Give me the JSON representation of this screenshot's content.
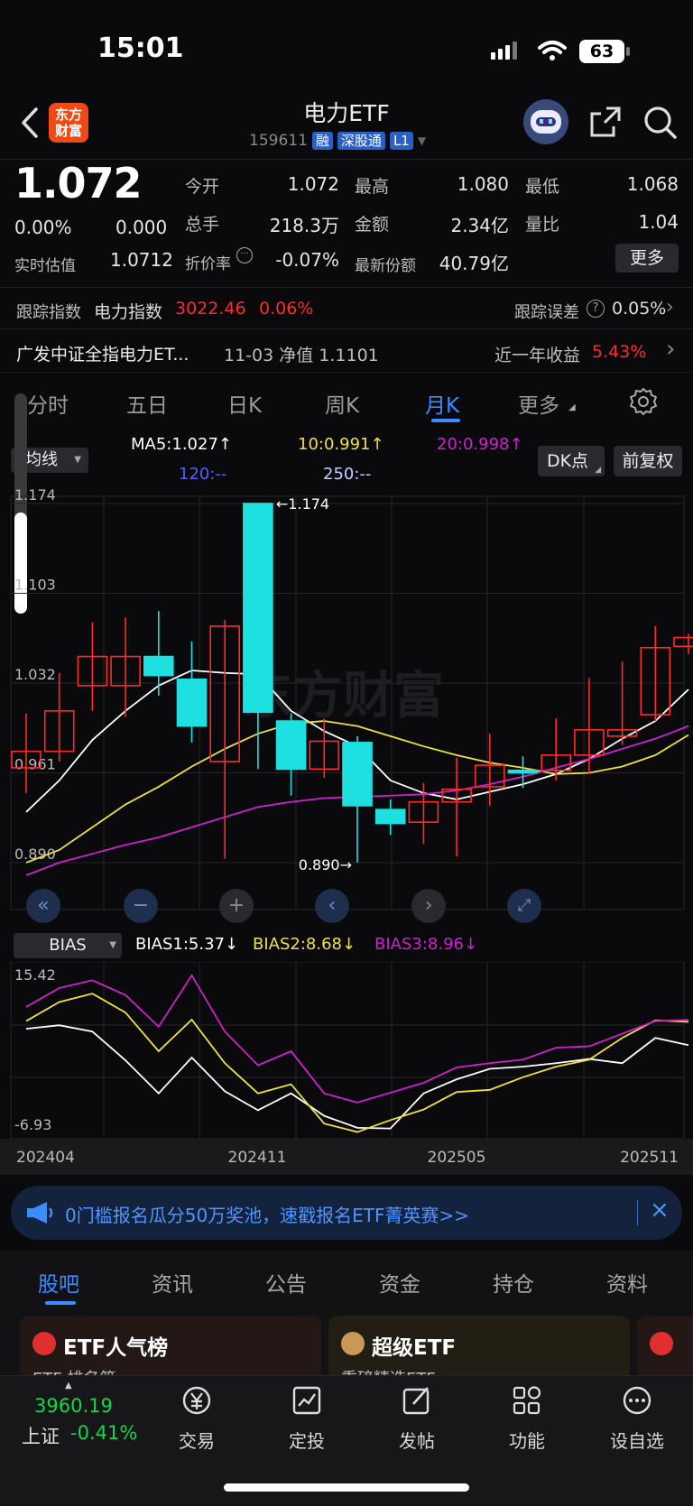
{
  "status_bar": {
    "time": "15:01",
    "battery": "63"
  },
  "header": {
    "logo_line1": "东方",
    "logo_line2": "财富",
    "title": "电力ETF",
    "code": "159611",
    "tags": [
      "融",
      "深股通",
      "L1"
    ]
  },
  "quote": {
    "price": "1.072",
    "change_pct": "0.00%",
    "change": "0.000",
    "iopv_label": "实时估值",
    "iopv": "1.0712",
    "open_label": "今开",
    "open": "1.072",
    "high_label": "最高",
    "high": "1.080",
    "low_label": "最低",
    "low": "1.068",
    "volume_label": "总手",
    "volume": "218.3万",
    "amount_label": "金额",
    "amount": "2.34亿",
    "ratio_label": "量比",
    "ratio": "1.04",
    "discount_label": "折价率",
    "discount": "-0.07%",
    "shares_label": "最新份额",
    "shares": "40.79亿",
    "more_button": "更多"
  },
  "tracking": {
    "label": "跟踪指数",
    "index_name": "电力指数",
    "index_value": "3022.46",
    "index_change": "0.06%",
    "error_label": "跟踪误差",
    "error_value": "0.05%"
  },
  "fund": {
    "name": "广发中证全指电力ET...",
    "nav_text": "11-03 净值 1.1101",
    "return_label": "近一年收益",
    "return_value": "5.43%"
  },
  "ktabs": {
    "items": [
      "分时",
      "五日",
      "日K",
      "周K",
      "月K",
      "更多"
    ],
    "active": "月K"
  },
  "ma": {
    "selector": "均线",
    "ma5": "MA5:1.027↑",
    "ma10": "10:0.991↑",
    "ma20": "20:0.998↑",
    "ma120": "120:--",
    "ma250": "250:--",
    "dk_button": "DK点",
    "adjust_button": "前复权"
  },
  "colors": {
    "up": "#ff2a2a",
    "down": "#1fe0e0",
    "ma5": "#ffffff",
    "ma10": "#f0e040",
    "ma20": "#d020d0",
    "ma120": "#5060ff",
    "ma250": "#c0d0ff",
    "accent": "#3b8cff"
  },
  "chart_data": [
    {
      "type": "candlestick",
      "title": "月K",
      "y_ticks": [
        "1.174",
        "1.103",
        "1.032",
        "0.961",
        "0.890"
      ],
      "ylim": [
        0.89,
        1.174
      ],
      "max_label": "1.174",
      "min_label": "0.890",
      "x_ticks": [
        "202404",
        "202411",
        "202505",
        "202511"
      ],
      "watermark": "东方财富",
      "candles": [
        {
          "o": 0.965,
          "c": 0.978,
          "h": 1.008,
          "l": 0.945
        },
        {
          "o": 0.978,
          "c": 1.01,
          "h": 1.04,
          "l": 0.97
        },
        {
          "o": 1.03,
          "c": 1.053,
          "h": 1.08,
          "l": 1.01
        },
        {
          "o": 1.03,
          "c": 1.053,
          "h": 1.084,
          "l": 1.005
        },
        {
          "o": 1.053,
          "c": 1.038,
          "h": 1.089,
          "l": 1.022
        },
        {
          "o": 1.035,
          "c": 0.998,
          "h": 1.065,
          "l": 0.985
        },
        {
          "o": 0.97,
          "c": 1.077,
          "h": 1.082,
          "l": 0.893
        },
        {
          "o": 1.174,
          "c": 1.009,
          "h": 1.174,
          "l": 0.964
        },
        {
          "o": 1.002,
          "c": 0.964,
          "h": 1.008,
          "l": 0.943
        },
        {
          "o": 0.964,
          "c": 0.986,
          "h": 1.004,
          "l": 0.957
        },
        {
          "o": 0.985,
          "c": 0.935,
          "h": 0.99,
          "l": 0.89
        },
        {
          "o": 0.932,
          "c": 0.921,
          "h": 0.94,
          "l": 0.912
        },
        {
          "o": 0.922,
          "c": 0.938,
          "h": 0.953,
          "l": 0.905
        },
        {
          "o": 0.938,
          "c": 0.948,
          "h": 0.973,
          "l": 0.895
        },
        {
          "o": 0.95,
          "c": 0.967,
          "h": 0.992,
          "l": 0.935
        },
        {
          "o": 0.963,
          "c": 0.961,
          "h": 0.974,
          "l": 0.949
        },
        {
          "o": 0.963,
          "c": 0.975,
          "h": 1.004,
          "l": 0.955
        },
        {
          "o": 0.975,
          "c": 0.995,
          "h": 1.036,
          "l": 0.96
        },
        {
          "o": 0.99,
          "c": 0.995,
          "h": 1.049,
          "l": 0.983
        },
        {
          "o": 1.007,
          "c": 1.06,
          "h": 1.077,
          "l": 1.002
        },
        {
          "o": 1.061,
          "c": 1.068,
          "h": 1.071,
          "l": 1.055
        }
      ],
      "series": [
        {
          "name": "MA5",
          "values": [
            0.93,
            0.955,
            0.987,
            1.01,
            1.03,
            1.042,
            1.04,
            1.039,
            1.01,
            0.994,
            0.982,
            0.955,
            0.945,
            0.94,
            0.946,
            0.952,
            0.96,
            0.972,
            0.988,
            1.002,
            1.027
          ]
        },
        {
          "name": "10",
          "values": [
            0.89,
            0.9,
            0.918,
            0.936,
            0.95,
            0.966,
            0.98,
            0.992,
            1.0,
            1.002,
            0.998,
            0.99,
            0.982,
            0.975,
            0.969,
            0.965,
            0.96,
            0.961,
            0.966,
            0.975,
            0.991
          ]
        },
        {
          "name": "20",
          "values": [
            0.88,
            0.89,
            0.897,
            0.904,
            0.91,
            0.918,
            0.926,
            0.934,
            0.938,
            0.941,
            0.942,
            0.943,
            0.944,
            0.947,
            0.952,
            0.958,
            0.965,
            0.972,
            0.98,
            0.988,
            0.998
          ]
        }
      ]
    },
    {
      "type": "line",
      "title": "BIAS",
      "ylim": [
        -6.93,
        15.42
      ],
      "y_ticks": [
        "15.42",
        "-6.93"
      ],
      "series": [
        {
          "name": "BIAS1:5.37↓",
          "values": [
            7.7,
            8.2,
            7.3,
            3.2,
            -1.5,
            3.6,
            -1.2,
            -3.9,
            -1.5,
            -4.7,
            -6.4,
            -6.5,
            -1.5,
            0.5,
            2.0,
            2.3,
            2.8,
            3.4,
            2.8,
            6.4,
            5.37
          ]
        },
        {
          "name": "BIAS2:8.68↓",
          "values": [
            8.8,
            11.5,
            12.7,
            10.0,
            4.5,
            9.0,
            2.8,
            -1.5,
            -0.2,
            -5.8,
            -7.0,
            -5.3,
            -3.8,
            -1.3,
            -1.0,
            0.8,
            2.3,
            3.3,
            6.4,
            8.9,
            8.68
          ]
        },
        {
          "name": "BIAS3:8.96↓",
          "values": [
            10.8,
            13.5,
            14.6,
            12.5,
            8.0,
            15.3,
            7.3,
            2.5,
            4.5,
            -1.5,
            -2.8,
            -1.4,
            0.0,
            2.2,
            2.8,
            3.3,
            5.0,
            5.2,
            7.0,
            8.8,
            8.96
          ]
        }
      ]
    }
  ],
  "bias": {
    "selector": "BIAS",
    "b1": "BIAS1:5.37↓",
    "b2": "BIAS2:8.68↓",
    "b3": "BIAS3:8.96↓"
  },
  "banner": {
    "text": "0门槛报名瓜分50万奖池，速戳报名ETF菁英赛>>"
  },
  "bottom_tabs": {
    "items": [
      "股吧",
      "资讯",
      "公告",
      "资金",
      "持仓",
      "资料"
    ],
    "active": "股吧"
  },
  "cards": [
    {
      "title": "ETF人气榜",
      "sub": "ETF 排名第"
    },
    {
      "title": "超级ETF",
      "sub": "重磅精选ETF"
    }
  ],
  "footer": {
    "index_value": "3960.19",
    "index_name": "上证",
    "index_change": "-0.41%",
    "nav": [
      "交易",
      "定投",
      "发帖",
      "功能",
      "设自选"
    ]
  }
}
